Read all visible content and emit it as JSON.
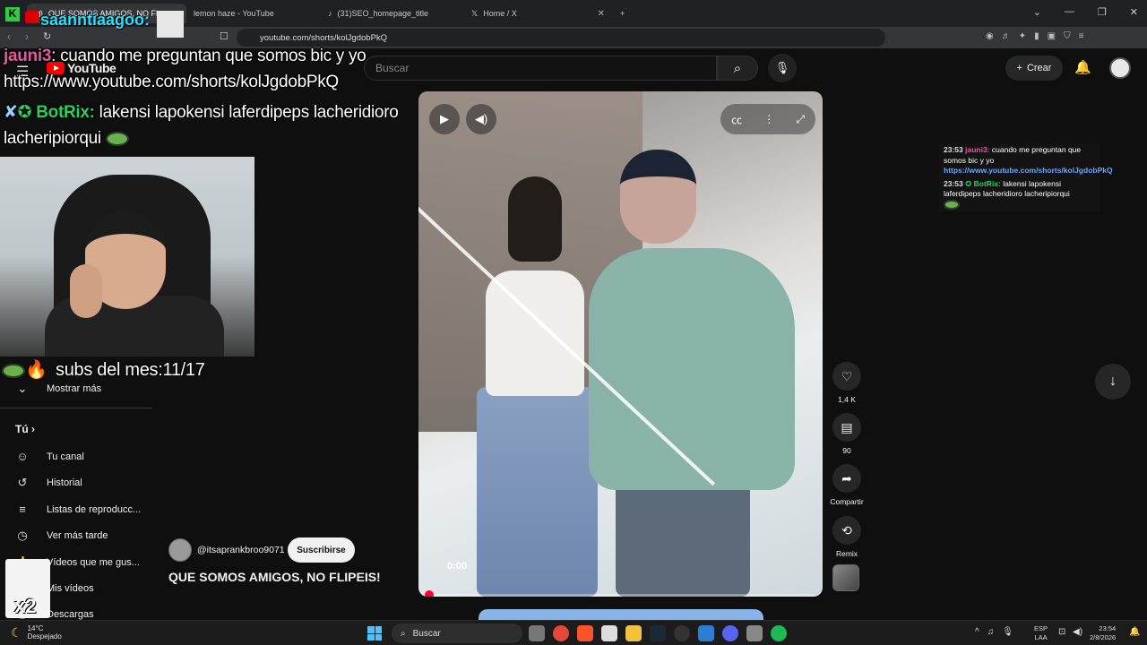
{
  "browser": {
    "tabs": [
      {
        "label": "QUE SOMOS AMIGOS, NO FL...",
        "active": true
      },
      {
        "label": "lemon haze - YouTube",
        "active": false
      },
      {
        "label": "(31)SEO_homepage_title",
        "active": false
      },
      {
        "label": "Home / X",
        "active": false
      }
    ],
    "new_tab": "+",
    "url": "youtube.com/shorts/kolJgdobPkQ"
  },
  "youtube": {
    "logo_text": "YouTube",
    "search_placeholder": "Buscar",
    "create_label": "Crear"
  },
  "sidebar": {
    "show_more": "Mostrar más",
    "you_heading": "Tú",
    "items": [
      {
        "label": "Tu canal",
        "icon": "channel-icon"
      },
      {
        "label": "Historial",
        "icon": "history-icon"
      },
      {
        "label": "Listas de reproducc...",
        "icon": "playlist-icon"
      },
      {
        "label": "Ver más tarde",
        "icon": "clock-icon"
      },
      {
        "label": "Vídeos que me gus...",
        "icon": "like-icon"
      },
      {
        "label": "Mis vídeos",
        "icon": "video-icon"
      },
      {
        "label": "Descargas",
        "icon": "download-icon"
      }
    ]
  },
  "player": {
    "time": "0:00",
    "progress": 0.0
  },
  "channel": {
    "handle": "@itsaprankbroo9071",
    "subscribe": "Suscribirse",
    "title": "QUE SOMOS AMIGOS, NO FLIPEIS!"
  },
  "actions": {
    "likes": "1,4 K",
    "comments": "90",
    "share": "Compartir",
    "remix": "Remix"
  },
  "overlay": {
    "top_user": "saanntiaagoo:",
    "chat1_user": "jauni3",
    "chat1_text": ": cuando me preguntan que somos bic y yo",
    "chat1_link": "https://www.youtube.com/shorts/kolJgdobPkQ",
    "chat2_user": "BotRix:",
    "chat2_text": " lakensi lapokensi laferdipeps lacheridioro",
    "chat2_text2": "lacheripiorqui",
    "subs_label": "subs del mes:11/17",
    "x2": "x2"
  },
  "mini_chat": {
    "line1_time": "23:53",
    "line1_user": "jauni3:",
    "line1_text": " cuando me preguntan que somos bic y yo",
    "line1_link": "https://www.youtube.com/shorts/kolJgdobPkQ",
    "line2_time": "23:53",
    "line2_user": "BotRix:",
    "line2_text": " lakensi lapokensi laferdipeps lacheridioro lacheripiorqui"
  },
  "taskbar": {
    "temp": "14°C",
    "weather": "Despejado",
    "search": "Buscar",
    "lang1": "ESP",
    "lang2": "LAA",
    "time": "23:54",
    "date": "2/8/2026"
  },
  "colors": {
    "accent_red": "#ff0033",
    "chat_pink": "#e05aa0",
    "chat_green": "#27d15a",
    "chat_cyan": "#29e1ff"
  }
}
